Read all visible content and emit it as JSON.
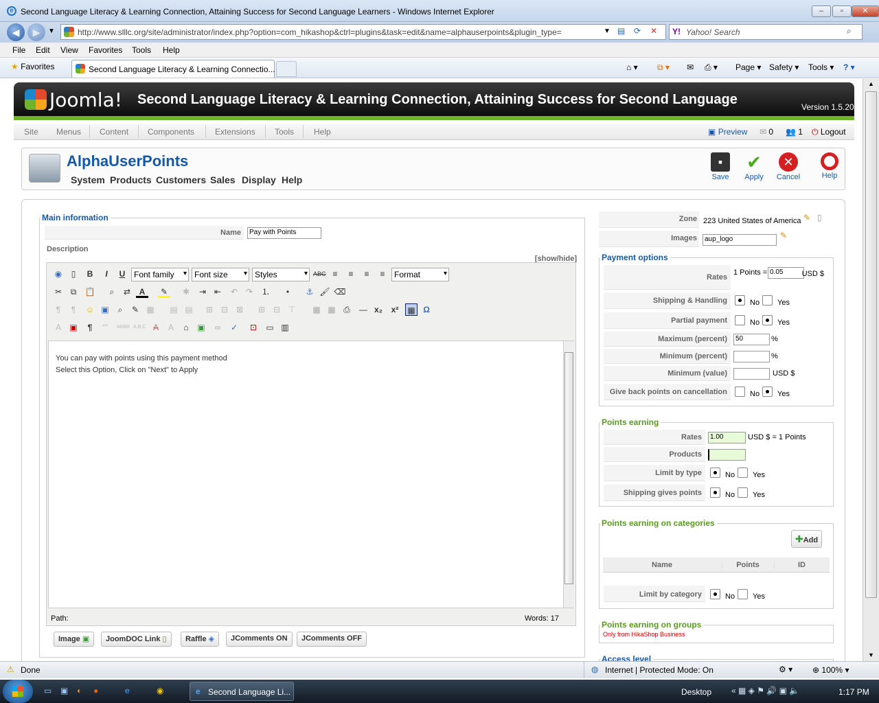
{
  "window": {
    "title": "Second Language Literacy & Learning Connection, Attaining Success for Second Language Learners  - Windows Internet Explorer"
  },
  "browser": {
    "url": "http://www.slllc.org/site/administrator/index.php?option=com_hikashop&ctrl=plugins&task=edit&name=alphauserpoints&plugin_type=",
    "search_placeholder": "Yahoo! Search",
    "menu": [
      "File",
      "Edit",
      "View",
      "Favorites",
      "Tools",
      "Help"
    ],
    "favorites": "Favorites",
    "tab_title": "Second Language Literacy & Learning Connectio...",
    "commands": {
      "page": "Page",
      "safety": "Safety",
      "tools": "Tools"
    }
  },
  "joomla": {
    "logo": "Joomla!",
    "site_title": "Second Language Literacy & Learning Connection, Attaining Success for Second Language",
    "version": "Version 1.5.20",
    "menu": [
      "Site",
      "Menus",
      "Content",
      "Components",
      "Extensions",
      "Tools",
      "Help"
    ],
    "status": {
      "preview": "Preview",
      "messages": "0",
      "users": "1",
      "logout": "Logout"
    }
  },
  "toolbar": {
    "title": "AlphaUserPoints",
    "submenu": [
      "System",
      "Products",
      "Customers",
      "Sales",
      "Display",
      "Help"
    ],
    "buttons": {
      "save": "Save",
      "apply": "Apply",
      "cancel": "Cancel",
      "help": "Help"
    }
  },
  "main": {
    "legend": "Main information",
    "name_label": "Name",
    "name_value": "Pay with Points",
    "description_label": "Description",
    "showhide": "[show/hide]",
    "editor": {
      "font_family": "Font family",
      "font_size": "Font size",
      "styles": "Styles",
      "format": "Format",
      "lines": [
        "You can pay with points using this payment method",
        "Select this Option, Click on \"Next\" to Apply"
      ],
      "path": "Path:",
      "words": "Words: 17"
    },
    "buttons": [
      "Image",
      "JoomDOC Link",
      "Raffle",
      "JComments ON",
      "JComments OFF"
    ]
  },
  "side": {
    "zone_label": "Zone",
    "zone_value": "223 United States of America",
    "images_label": "Images",
    "images_value": "aup_logo",
    "payment": {
      "legend": "Payment options",
      "rates_label": "Rates",
      "rates_prefix": "1 Points =",
      "rates_value": "0.05",
      "rates_currency": "USD $",
      "shipping_label": "Shipping & Handling",
      "partial_label": "Partial payment",
      "max_label": "Maximum (percent)",
      "max_value": "50",
      "percent": "%",
      "min_label": "Minimum (percent)",
      "minval_label": "Minimum (value)",
      "minval_currency": "USD $",
      "giveback_label": "Give back points on cancellation",
      "no": "No",
      "yes": "Yes"
    },
    "earning": {
      "legend": "Points earning",
      "rates_label": "Rates",
      "rates_value": "1.00",
      "rates_suffix": "USD $ = 1 Points",
      "products_label": "Products",
      "limit_type_label": "Limit by type",
      "shipping_label": "Shipping gives points"
    },
    "categories": {
      "legend": "Points earning on categories",
      "add": "Add",
      "columns": [
        "Name",
        "Points",
        "ID"
      ],
      "limit_label": "Limit by category"
    },
    "groups": {
      "legend": "Points earning on groups",
      "note": "Only from HikaShop Business"
    },
    "access": {
      "legend": "Access level"
    }
  },
  "statusbar": {
    "done": "Done",
    "zone": "Internet | Protected Mode: On",
    "zoom": "100%"
  },
  "taskbar": {
    "task": "Second Language Li...",
    "desktop": "Desktop",
    "time": "1:17 PM"
  }
}
